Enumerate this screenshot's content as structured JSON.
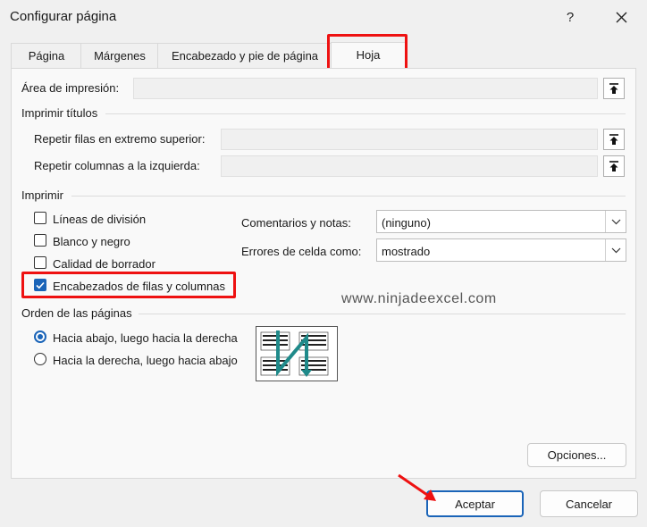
{
  "window": {
    "title": "Configurar página",
    "help_label": "?",
    "close_label": "✕"
  },
  "tabs": [
    {
      "label": "Página",
      "active": false
    },
    {
      "label": "Márgenes",
      "active": false
    },
    {
      "label": "Encabezado y pie de página",
      "active": false
    },
    {
      "label": "Hoja",
      "active": true
    }
  ],
  "print_area": {
    "label": "Área de impresión:",
    "value": ""
  },
  "print_titles": {
    "group_label": "Imprimir títulos",
    "rows_label": "Repetir filas en extremo superior:",
    "rows_value": "",
    "cols_label": "Repetir columnas a la izquierda:",
    "cols_value": ""
  },
  "print": {
    "group_label": "Imprimir",
    "checkboxes": [
      {
        "label": "Líneas de división",
        "checked": false
      },
      {
        "label": "Blanco y negro",
        "checked": false
      },
      {
        "label": "Calidad de borrador",
        "checked": false
      },
      {
        "label": "Encabezados de filas y columnas",
        "checked": true
      }
    ],
    "comments_label": "Comentarios y notas:",
    "comments_value": "(ninguno)",
    "errors_label": "Errores de celda como:",
    "errors_value": "mostrado"
  },
  "page_order": {
    "group_label": "Orden de las páginas",
    "options": [
      {
        "label": "Hacia abajo, luego hacia la derecha",
        "selected": true
      },
      {
        "label": "Hacia la derecha, luego hacia abajo",
        "selected": false
      }
    ]
  },
  "watermark": "www.ninjadeexcel.com",
  "buttons": {
    "options": "Opciones...",
    "ok": "Aceptar",
    "cancel": "Cancelar"
  },
  "colors": {
    "accent": "#1a64b8",
    "highlight": "#e11111",
    "preview_arrow": "#1f8a8a"
  }
}
